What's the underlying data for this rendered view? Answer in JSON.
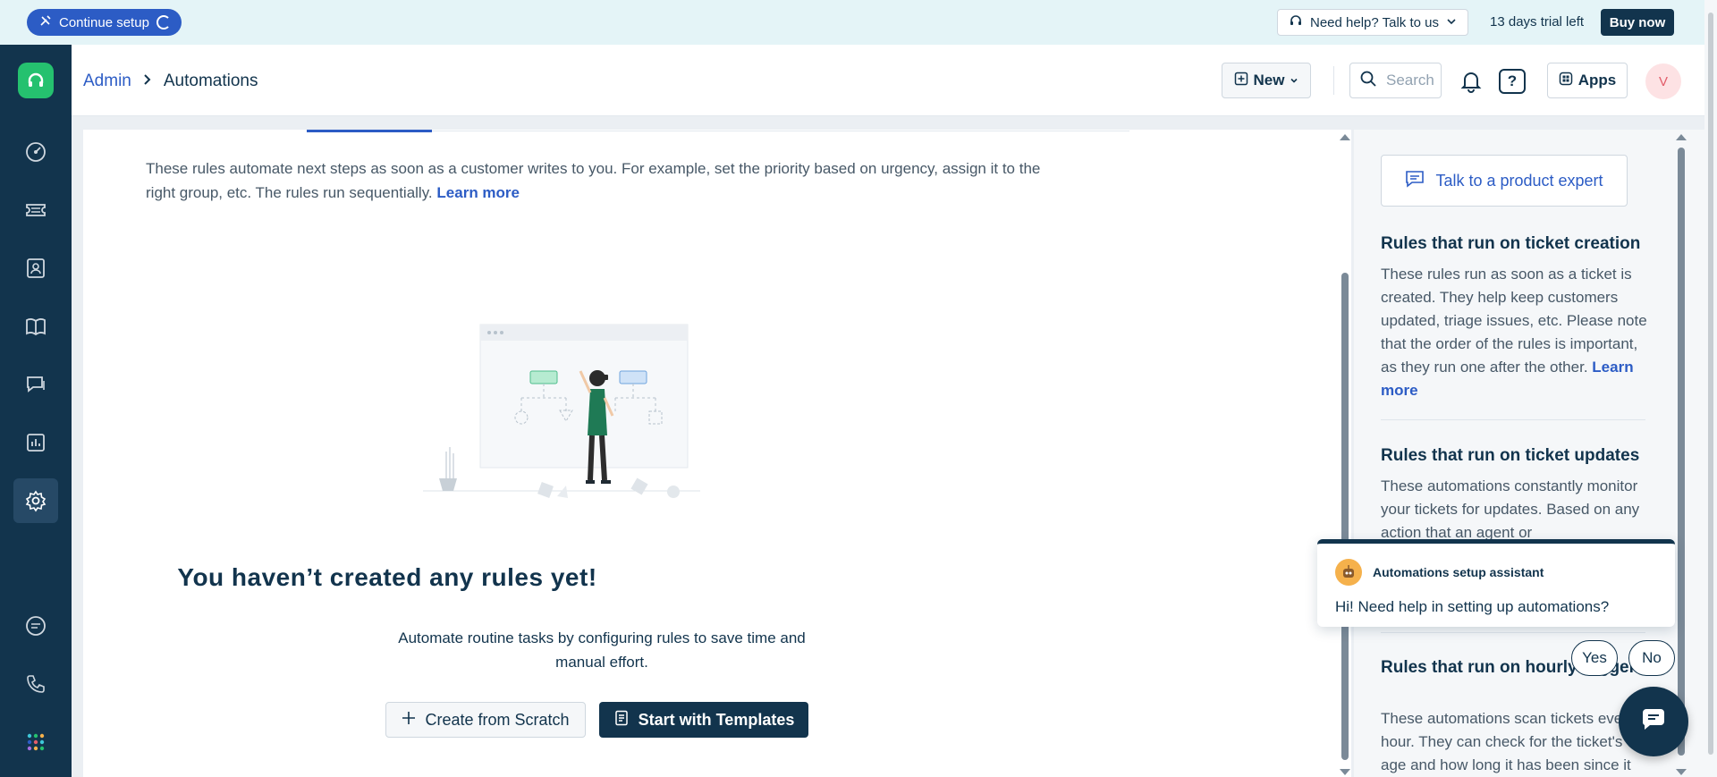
{
  "banner": {
    "setup_label": "Continue setup",
    "help_label": "Need help? Talk to us",
    "trial_text": "13 days trial left",
    "buy_label": "Buy now"
  },
  "header": {
    "breadcrumb_parent": "Admin",
    "breadcrumb_current": "Automations",
    "new_label": "New",
    "search_placeholder": "Search",
    "help_symbol": "?",
    "apps_label": "Apps",
    "avatar_initial": "V"
  },
  "main": {
    "description": "These rules automate next steps as soon as a customer writes to you. For example, set the priority based on urgency, assign it to the right group, etc. The rules run sequentially.",
    "learn_more": "Learn more",
    "empty_title": "You haven’t created any rules yet!",
    "empty_subtitle": "Automate routine tasks by configuring rules to save time and manual effort.",
    "create_scratch_label": "Create from Scratch",
    "start_templates_label": "Start with Templates"
  },
  "side": {
    "expert_label": "Talk to a product expert",
    "sections": [
      {
        "title": "Rules that run on ticket creation",
        "text": "These rules run as soon as a ticket is created. They help keep customers updated, triage issues, etc. Please note that the order of the rules is important, as they run one after the other.",
        "link": "Learn more"
      },
      {
        "title": "Rules that run on ticket updates",
        "text": "These automations constantly monitor your tickets for updates. Based on any action that an agent or"
      },
      {
        "title": "Rules that run on hourly triggers",
        "text": "These automations scan tickets every hour. They can check for the ticket's age and how long it has been since it"
      }
    ]
  },
  "assistant": {
    "name": "Automations setup assistant",
    "message": "Hi! Need help in setting up automations?",
    "yes_label": "Yes",
    "no_label": "No"
  },
  "colors": {
    "navy": "#12344d",
    "accent_blue": "#2c5cc5",
    "brand_green": "#25c16f"
  },
  "icons": [
    "tools-icon",
    "headset-icon",
    "chevron-down-icon",
    "plus-square-icon",
    "search-icon",
    "bell-icon",
    "help-icon",
    "apps-icon",
    "dashboard-icon",
    "ticket-icon",
    "contacts-icon",
    "book-icon",
    "chat-icon",
    "report-icon",
    "gear-icon",
    "message-icon",
    "phone-icon",
    "grid-icon",
    "chat-bubble-icon",
    "document-icon"
  ]
}
